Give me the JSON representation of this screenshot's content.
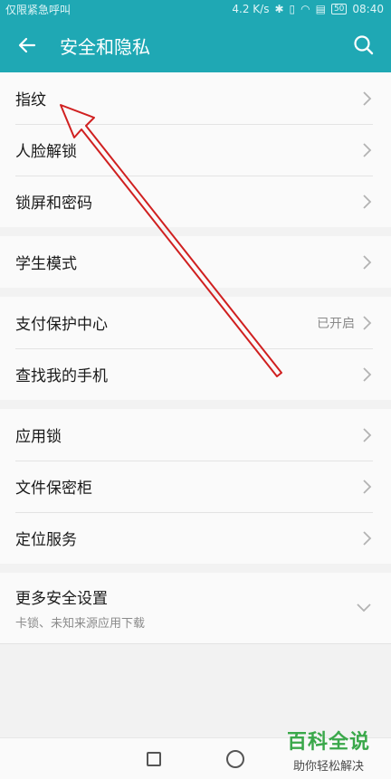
{
  "status_bar": {
    "carrier": "仅限紧急呼叫",
    "speed": "4.2 K/s",
    "battery": "50",
    "time": "08:40"
  },
  "app_bar": {
    "title": "安全和隐私"
  },
  "groups": [
    {
      "items": [
        {
          "label": "指纹"
        },
        {
          "label": "人脸解锁"
        },
        {
          "label": "锁屏和密码"
        }
      ]
    },
    {
      "items": [
        {
          "label": "学生模式"
        }
      ]
    },
    {
      "items": [
        {
          "label": "支付保护中心",
          "value": "已开启"
        },
        {
          "label": "查找我的手机"
        }
      ]
    },
    {
      "items": [
        {
          "label": "应用锁"
        },
        {
          "label": "文件保密柜"
        },
        {
          "label": "定位服务"
        }
      ]
    },
    {
      "items": [
        {
          "label": "更多安全设置",
          "subtitle": "卡锁、未知来源应用下载"
        }
      ]
    }
  ],
  "watermark": {
    "main": "百科全说",
    "sub": "助你轻松解决"
  },
  "colors": {
    "accent": "#1fa8b4",
    "annotation_arrow": "#d02020"
  }
}
